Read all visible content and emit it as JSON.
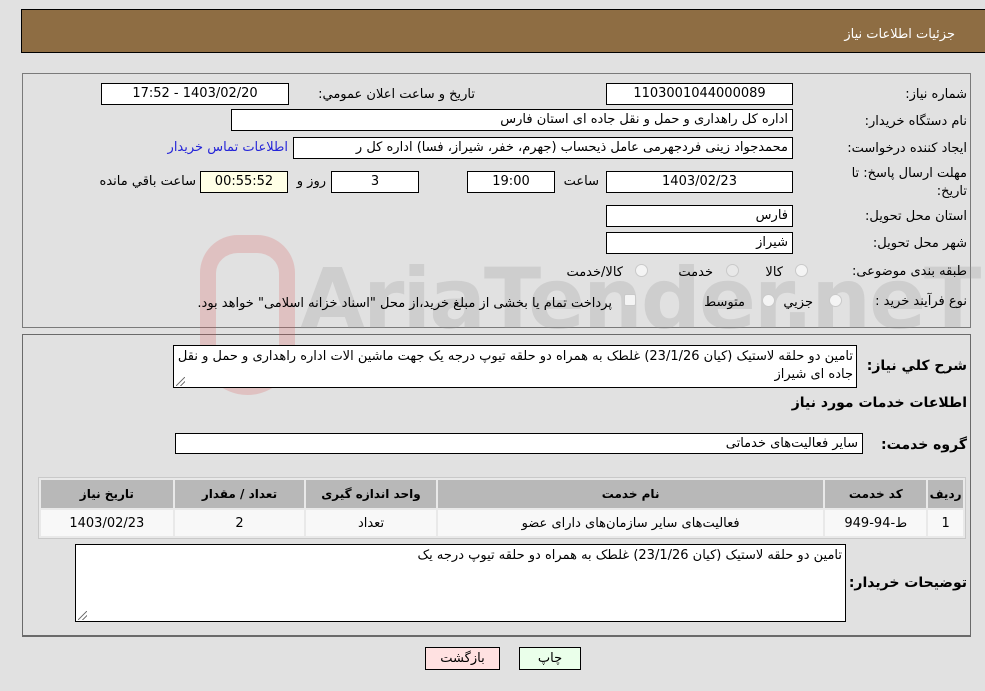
{
  "header": {
    "title": "جزئیات اطلاعات نیاز"
  },
  "watermark": "AriaTender.neT",
  "fields": {
    "need_number_label": "شماره نیاز:",
    "need_number": "1103001044000089",
    "announce_label": "تاریخ و ساعت اعلان عمومي:",
    "announce_value": "1403/02/20 - 17:52",
    "buyer_org_label": "نام دستگاه خریدار:",
    "buyer_org": "اداره کل راهداری و حمل و نقل جاده ای استان فارس",
    "creator_label": "ایجاد کننده درخواست:",
    "creator": "محمدجواد زینی فردجهرمی عامل ذیحساب (جهرم، خفر، شیراز، فسا) اداره کل ر",
    "contact_link": "اطلاعات تماس خریدار",
    "deadline_label": "مهلت ارسال پاسخ: تا تاریخ:",
    "deadline_date": "1403/02/23",
    "time_label": "ساعت",
    "deadline_time": "19:00",
    "days_value": "3",
    "days_label": "روز و",
    "remaining_time": "00:55:52",
    "remaining_label": "ساعت باقي مانده",
    "province_label": "استان محل تحویل:",
    "province": "فارس",
    "city_label": "شهر محل تحویل:",
    "city": "شیراز",
    "category_label": "طبقه بندی موضوعی:",
    "category_options": [
      "کالا",
      "خدمت",
      "کالا/خدمت"
    ],
    "category_selected": "خدمت",
    "process_label": "نوع فرآیند خرید :",
    "process_options": [
      "جزيي",
      "متوسط"
    ],
    "treasury_note": "پرداخت تمام یا بخشی از مبلغ خرید،از محل \"اسناد خزانه اسلامی\" خواهد بود."
  },
  "details": {
    "summary_label": "شرح کلي نیاز:",
    "summary": "تامین دو حلقه لاستیک (کیان 23/1/26) غلطک به همراه دو حلقه تیوپ درجه یک جهت ماشین الات اداره راهداری و حمل و نقل جاده ای شیراز",
    "services_heading": "اطلاعات خدمات مورد نیاز",
    "service_group_label": "گروه خدمت:",
    "service_group": "سایر فعالیت‌های خدماتی",
    "table": {
      "headers": [
        "ردیف",
        "کد خدمت",
        "نام خدمت",
        "واحد اندازه گیری",
        "تعداد / مقدار",
        "تاریخ نیاز"
      ],
      "rows": [
        [
          "1",
          "ط-94-949",
          "فعالیت‌های سایر سازمان‌های دارای عضو",
          "تعداد",
          "2",
          "1403/02/23"
        ]
      ]
    },
    "buyer_notes_label": "توضیحات خریدار:",
    "buyer_notes": "تامین دو حلقه لاستیک (کیان 23/1/26) غلطک به همراه دو حلقه تیوپ درجه یک"
  },
  "buttons": {
    "print": "چاپ",
    "back": "بازگشت"
  },
  "colors": {
    "header_bg": "#8e6d43",
    "link": "#2525d8",
    "print_bg": "#eaffea",
    "back_bg": "#ffe1e1"
  }
}
